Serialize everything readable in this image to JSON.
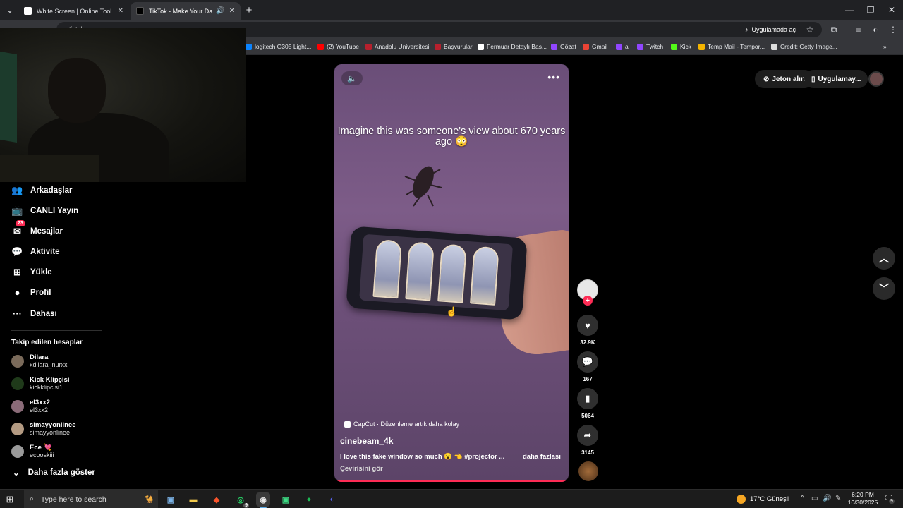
{
  "browser": {
    "tabs": [
      {
        "title": "White Screen | Online Tool",
        "close": "✕"
      },
      {
        "title": "TikTok - Make Your Day",
        "close": "✕",
        "audio": "🔊"
      }
    ],
    "new_tab": "+",
    "address_bar_text": "tiktok.com",
    "open_in_app": "Uygulamada aç",
    "bookmarks": [
      {
        "label": "logitech G305 Light...",
        "color": "#0b84ff"
      },
      {
        "label": "(2) YouTube",
        "color": "#ff0000"
      },
      {
        "label": "Anadolu Üniversitesi",
        "color": "#b7202d"
      },
      {
        "label": "Başvurular",
        "color": "#b7202d"
      },
      {
        "label": "Fermuar Detaylı Bas...",
        "color": "#ffffff"
      },
      {
        "label": "Gözat",
        "color": "#9146ff"
      },
      {
        "label": "Gmail",
        "color": "#ea4335"
      },
      {
        "label": "a",
        "color": "#9146ff"
      },
      {
        "label": "Twitch",
        "color": "#9146ff"
      },
      {
        "label": "Kick",
        "color": "#53fc18"
      },
      {
        "label": "Temp Mail - Tempor...",
        "color": "#f4b400"
      },
      {
        "label": "Credit: Getty Image...",
        "color": "#dddddd"
      }
    ]
  },
  "sidebar": {
    "items": [
      {
        "label": "Arkadaşlar",
        "icon": "friends-icon",
        "glyph": "👥"
      },
      {
        "label": "CANLI Yayın",
        "icon": "live-icon",
        "glyph": "📺"
      },
      {
        "label": "Mesajlar",
        "icon": "messages-icon",
        "glyph": "✉",
        "badge": "23"
      },
      {
        "label": "Aktivite",
        "icon": "activity-icon",
        "glyph": "💬"
      },
      {
        "label": "Yükle",
        "icon": "upload-icon",
        "glyph": "⊞"
      },
      {
        "label": "Profil",
        "icon": "profile-icon",
        "glyph": "●"
      },
      {
        "label": "Dahası",
        "icon": "more-icon",
        "glyph": "···"
      }
    ],
    "following_title": "Takip edilen hesaplar",
    "following": [
      {
        "name": "Dilara",
        "handle": "xdilara_nurxx"
      },
      {
        "name": "Kick Klipçisi",
        "handle": "kickklipcisi1"
      },
      {
        "name": "el3xx2",
        "handle": "el3xx2"
      },
      {
        "name": "simayyonlinee",
        "handle": "simayyonlinee"
      },
      {
        "name": "Ece 💘",
        "handle": "ecooskiii"
      }
    ],
    "see_more": "Daha fazla göster"
  },
  "video": {
    "caption": "Imagine this was someone's view about 670 years ago 😳",
    "capcut": "CapCut · Düzenleme artık daha kolay",
    "author": "cinebeam_4k",
    "description": "I love this fake window so much 😮 👈 #projector ...",
    "more": "daha fazlası",
    "translate": "Çevirisini gör",
    "mute_icon": "🔈",
    "menu_icon": "•••",
    "progress": 1.0
  },
  "actions": {
    "likes": "32.9K",
    "comments": "167",
    "saves": "5064",
    "shares": "3145"
  },
  "header": {
    "coins": "Jeton alın",
    "get_app": "Uygulamay..."
  },
  "taskbar": {
    "search_placeholder": "Type here to search",
    "weather": "17°C  Güneşli",
    "time": "6:20 PM",
    "date": "10/30/2025",
    "whatsapp_badge": "9",
    "notif_badge": "9"
  }
}
